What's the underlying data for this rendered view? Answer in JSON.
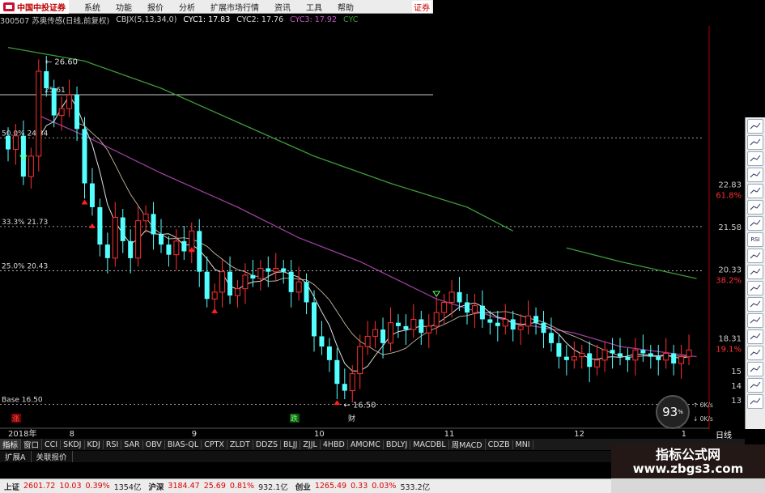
{
  "menubar": {
    "logo_text": "中国中投证券",
    "items": [
      "系统",
      "功能",
      "报价",
      "分析",
      "扩展市场行情",
      "资讯",
      "工具",
      "帮助"
    ],
    "broker_text": "证券"
  },
  "infobar": {
    "stock_title": "300507 苏奥传感(日线,前复权)",
    "indicator": "CBJX(5,13,34,0)",
    "cyc1": "CYC1: 17.83",
    "cyc2": "CYC2: 17.76",
    "cyc3": "CYC3: 17.92",
    "cyc4": "CYC"
  },
  "colors": {
    "up": "#ff3030",
    "down": "#54ffff",
    "ma_white": "#e0e0e0",
    "ma_green": "#3f9a3a",
    "ma_purple": "#9c3f9c",
    "hline": "#cccccc",
    "axis": "#b00000"
  },
  "chart_data": {
    "type": "candlestick",
    "y_axis_labels": [
      {
        "value": 22.83,
        "text": "22.83",
        "pct": "61.8%"
      },
      {
        "value": 21.58,
        "text": "21.58",
        "pct": ""
      },
      {
        "value": 20.33,
        "text": "20.33",
        "pct": "38.2%"
      },
      {
        "value": 18.31,
        "text": "18.31",
        "pct": "19.1%"
      }
    ],
    "right_ticks": [
      "15",
      "14",
      "13"
    ],
    "fib_lines": [
      {
        "value": 25.61,
        "text": "25.61",
        "partial": true
      },
      {
        "value": 24.34,
        "text": "50.0% 24.34"
      },
      {
        "value": 21.73,
        "text": "33.3% 21.73"
      },
      {
        "value": 20.43,
        "text": "25.0% 20.43"
      },
      {
        "value": 16.5,
        "text": "Base 16.50"
      }
    ],
    "annotations": {
      "high": "26.60",
      "low": "16.50",
      "tag_zhang": "涨",
      "tag_die": "跌",
      "tag_cai": "财"
    },
    "x_labels": [
      {
        "text": "2018年",
        "i": 0
      },
      {
        "text": "8",
        "i": 8
      },
      {
        "text": "9",
        "i": 24
      },
      {
        "text": "10",
        "i": 40
      },
      {
        "text": "11",
        "i": 57
      },
      {
        "text": "12",
        "i": 74
      },
      {
        "text": "1",
        "i": 88
      }
    ],
    "ylim": [
      16.2,
      27.3
    ],
    "closes": [
      24.0,
      24.4,
      23.2,
      23.8,
      26.3,
      25.8,
      25.0,
      25.2,
      25.6,
      24.6,
      23.0,
      22.3,
      21.2,
      20.8,
      22.0,
      21.3,
      20.8,
      21.9,
      22.1,
      21.5,
      21.2,
      20.9,
      21.3,
      21.0,
      21.6,
      20.4,
      19.6,
      19.8,
      20.4,
      19.7,
      19.9,
      20.3,
      20.2,
      20.5,
      20.4,
      20.5,
      20.4,
      19.8,
      20.1,
      19.5,
      18.5,
      18.2,
      17.8,
      17.1,
      16.9,
      17.4,
      18.2,
      18.5,
      18.7,
      18.3,
      18.9,
      18.8,
      18.7,
      19.0,
      18.6,
      18.8,
      19.2,
      19.5,
      19.8,
      19.5,
      19.2,
      19.4,
      19.0,
      18.9,
      18.8,
      19.0,
      18.7,
      18.8,
      19.1,
      18.9,
      18.6,
      18.3,
      17.9,
      17.8,
      17.9,
      18.0,
      17.6,
      17.8,
      18.1,
      18.0,
      17.9,
      17.8,
      18.1,
      18.0,
      17.9,
      17.8,
      18.0,
      17.7,
      17.9,
      18.1
    ],
    "ma_green": [
      [
        0,
        27.0
      ],
      [
        10,
        26.6
      ],
      [
        20,
        25.8
      ],
      [
        30,
        24.8
      ],
      [
        40,
        23.8
      ],
      [
        50,
        23.0
      ],
      [
        60,
        22.3
      ],
      [
        66,
        21.6
      ]
    ],
    "ma_green_tail": [
      [
        73,
        21.1
      ],
      [
        80,
        20.7
      ],
      [
        90,
        20.2
      ]
    ],
    "ma_purple": [
      [
        4,
        25.0
      ],
      [
        10,
        24.4
      ],
      [
        20,
        23.3
      ],
      [
        30,
        22.3
      ],
      [
        38,
        21.4
      ],
      [
        46,
        20.7
      ],
      [
        56,
        19.6
      ],
      [
        66,
        18.9
      ],
      [
        74,
        18.6
      ],
      [
        80,
        18.2
      ],
      [
        90,
        17.9
      ]
    ]
  },
  "speed_widget": {
    "percent": "93",
    "unit": "%",
    "up_rate": "0K/s",
    "down_rate": "0K/s"
  },
  "ticktabs": [
    "指标",
    "窗口",
    "CCI",
    "SKDJ",
    "KDJ",
    "RSI",
    "SAR",
    "OBV",
    "BIAS-QL",
    "CPTX",
    "ZLDT",
    "DDZS",
    "BLJJ",
    "ZJJL",
    "4HBD",
    "AMOMC",
    "BDLYJ",
    "MACDBL",
    "周MACD",
    "CDZB",
    "MNI"
  ],
  "period_label": "日线",
  "lowtabs": [
    "扩展A",
    "关联报价"
  ],
  "statusbar": {
    "sh_name": "上证",
    "sh_val": "2601.72",
    "sh_chg": "10.03",
    "sh_pct": "0.39%",
    "sh_vol": "1354亿",
    "sz_name": "沪深",
    "sz_val": "3184.47",
    "sz_chg": "25.69",
    "sz_pct": "0.81%",
    "sz_vol": "932.1亿",
    "cy_name": "创业",
    "cy_val": "1265.49",
    "cy_chg": "0.33",
    "cy_pct": "0.03%",
    "cy_vol": "533.2亿"
  },
  "watermark": {
    "line1": "指标公式网",
    "line2": "www.zbgs3.com"
  },
  "right_toolbar_icons": [
    "icon-1",
    "icon-2",
    "icon-3",
    "icon-4",
    "icon-5",
    "icon-6",
    "icon-7",
    "RSI",
    "icon-9",
    "icon-10",
    "icon-11",
    "icon-12",
    "icon-13",
    "icon-14",
    "icon-15",
    "icon-16",
    "icon-17",
    "icon-18"
  ]
}
